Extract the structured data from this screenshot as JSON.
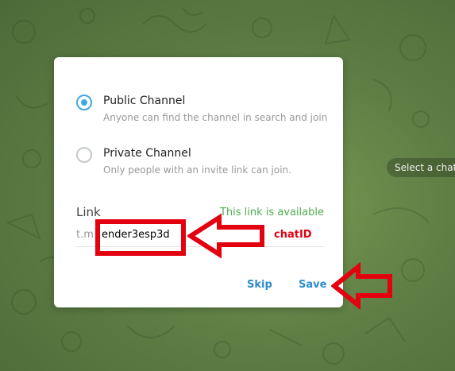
{
  "background": {
    "chat_hint": "Select a chat"
  },
  "dialog": {
    "options": [
      {
        "title": "Public Channel",
        "description": "Anyone can find the channel in search and join",
        "selected": true
      },
      {
        "title": "Private Channel",
        "description": "Only people with an invite link can join.",
        "selected": false
      }
    ],
    "link": {
      "label": "Link",
      "status": "This link is available",
      "prefix": "t.m",
      "value": "ender3esp3d"
    },
    "buttons": {
      "skip": "Skip",
      "save": "Save"
    }
  },
  "annotation": {
    "text": "chatID",
    "color": "#e3000f"
  },
  "colors": {
    "accent": "#40a7e3",
    "button": "#2d8ccd",
    "available": "#4fae4e"
  }
}
